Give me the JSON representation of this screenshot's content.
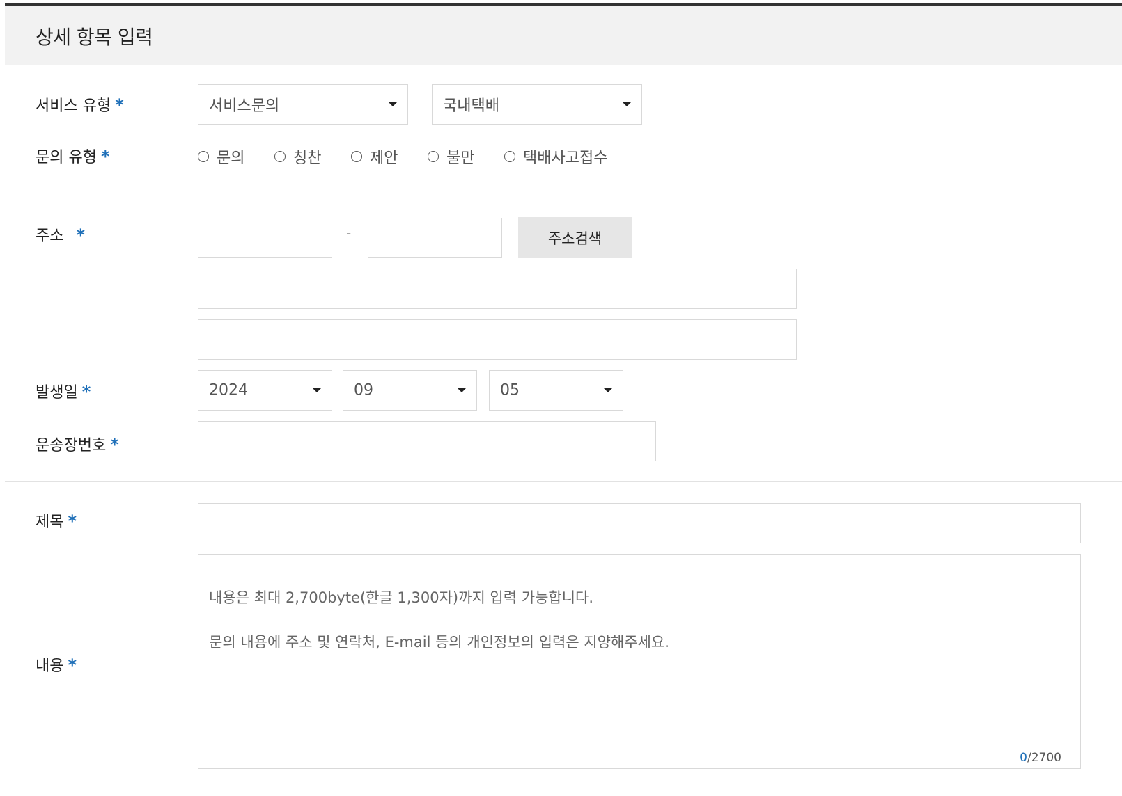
{
  "section": {
    "title": "상세 항목 입력"
  },
  "required_mark": "*",
  "service_type": {
    "label": "서비스 유형",
    "select1": "서비스문의",
    "select2": "국내택배"
  },
  "inquiry_type": {
    "label": "문의 유형",
    "options": [
      "문의",
      "칭찬",
      "제안",
      "불만",
      "택배사고접수"
    ]
  },
  "address": {
    "label": "주소",
    "dash": "-",
    "search_button": "주소검색"
  },
  "date": {
    "label": "발생일",
    "year": "2024",
    "month": "09",
    "day": "05"
  },
  "waybill": {
    "label": "운송장번호"
  },
  "subject": {
    "label": "제목"
  },
  "content": {
    "label": "내용",
    "placeholder_line1": "내용은 최대 2,700byte(한글 1,300자)까지 입력 가능합니다.",
    "placeholder_line2": "문의 내용에 주소 및 연락처, E-mail 등의 개인정보의 입력은 지양해주세요.",
    "counter_current": "0",
    "counter_max": "/2700"
  },
  "colors": {
    "required_mark": "#1e6fb8",
    "header_bg": "#f2f2f2",
    "button_bg": "#e6e6e6"
  }
}
